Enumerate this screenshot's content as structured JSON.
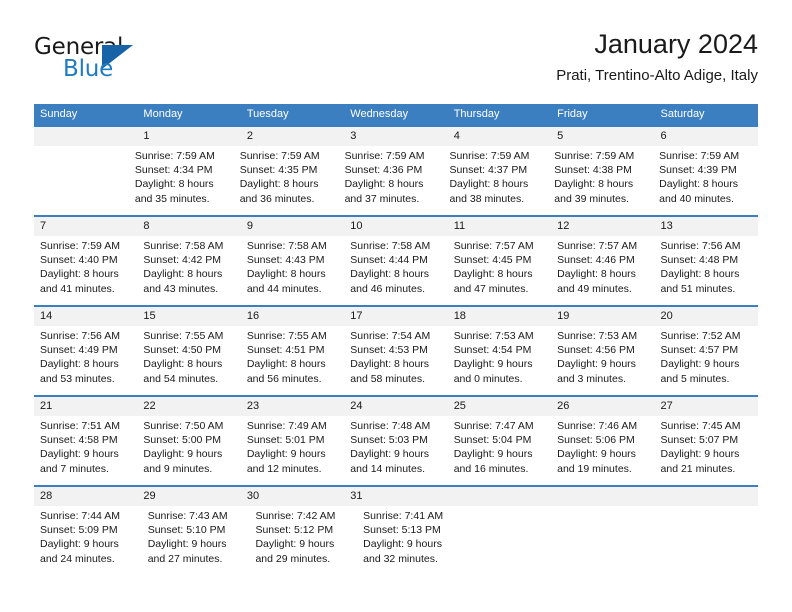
{
  "brand": {
    "name_top": "General",
    "name_bottom": "Blue",
    "triangle_color": "#1663a8",
    "blue_text_color": "#1f7bc1",
    "logo_icon": "general-blue-triangle-logo"
  },
  "header": {
    "title": "January 2024",
    "subtitle": "Prati, Trentino-Alto Adige, Italy"
  },
  "calendar": {
    "accent_color": "#3c7fc0",
    "daynum_band_color": "#f2f2f2",
    "weekdays": [
      "Sunday",
      "Monday",
      "Tuesday",
      "Wednesday",
      "Thursday",
      "Friday",
      "Saturday"
    ],
    "weeks": [
      {
        "days": [
          {
            "num": "",
            "lines": []
          },
          {
            "num": "1",
            "lines": [
              "Sunrise: 7:59 AM",
              "Sunset: 4:34 PM",
              "Daylight: 8 hours",
              "and 35 minutes."
            ]
          },
          {
            "num": "2",
            "lines": [
              "Sunrise: 7:59 AM",
              "Sunset: 4:35 PM",
              "Daylight: 8 hours",
              "and 36 minutes."
            ]
          },
          {
            "num": "3",
            "lines": [
              "Sunrise: 7:59 AM",
              "Sunset: 4:36 PM",
              "Daylight: 8 hours",
              "and 37 minutes."
            ]
          },
          {
            "num": "4",
            "lines": [
              "Sunrise: 7:59 AM",
              "Sunset: 4:37 PM",
              "Daylight: 8 hours",
              "and 38 minutes."
            ]
          },
          {
            "num": "5",
            "lines": [
              "Sunrise: 7:59 AM",
              "Sunset: 4:38 PM",
              "Daylight: 8 hours",
              "and 39 minutes."
            ]
          },
          {
            "num": "6",
            "lines": [
              "Sunrise: 7:59 AM",
              "Sunset: 4:39 PM",
              "Daylight: 8 hours",
              "and 40 minutes."
            ]
          }
        ]
      },
      {
        "days": [
          {
            "num": "7",
            "lines": [
              "Sunrise: 7:59 AM",
              "Sunset: 4:40 PM",
              "Daylight: 8 hours",
              "and 41 minutes."
            ]
          },
          {
            "num": "8",
            "lines": [
              "Sunrise: 7:58 AM",
              "Sunset: 4:42 PM",
              "Daylight: 8 hours",
              "and 43 minutes."
            ]
          },
          {
            "num": "9",
            "lines": [
              "Sunrise: 7:58 AM",
              "Sunset: 4:43 PM",
              "Daylight: 8 hours",
              "and 44 minutes."
            ]
          },
          {
            "num": "10",
            "lines": [
              "Sunrise: 7:58 AM",
              "Sunset: 4:44 PM",
              "Daylight: 8 hours",
              "and 46 minutes."
            ]
          },
          {
            "num": "11",
            "lines": [
              "Sunrise: 7:57 AM",
              "Sunset: 4:45 PM",
              "Daylight: 8 hours",
              "and 47 minutes."
            ]
          },
          {
            "num": "12",
            "lines": [
              "Sunrise: 7:57 AM",
              "Sunset: 4:46 PM",
              "Daylight: 8 hours",
              "and 49 minutes."
            ]
          },
          {
            "num": "13",
            "lines": [
              "Sunrise: 7:56 AM",
              "Sunset: 4:48 PM",
              "Daylight: 8 hours",
              "and 51 minutes."
            ]
          }
        ]
      },
      {
        "days": [
          {
            "num": "14",
            "lines": [
              "Sunrise: 7:56 AM",
              "Sunset: 4:49 PM",
              "Daylight: 8 hours",
              "and 53 minutes."
            ]
          },
          {
            "num": "15",
            "lines": [
              "Sunrise: 7:55 AM",
              "Sunset: 4:50 PM",
              "Daylight: 8 hours",
              "and 54 minutes."
            ]
          },
          {
            "num": "16",
            "lines": [
              "Sunrise: 7:55 AM",
              "Sunset: 4:51 PM",
              "Daylight: 8 hours",
              "and 56 minutes."
            ]
          },
          {
            "num": "17",
            "lines": [
              "Sunrise: 7:54 AM",
              "Sunset: 4:53 PM",
              "Daylight: 8 hours",
              "and 58 minutes."
            ]
          },
          {
            "num": "18",
            "lines": [
              "Sunrise: 7:53 AM",
              "Sunset: 4:54 PM",
              "Daylight: 9 hours",
              "and 0 minutes."
            ]
          },
          {
            "num": "19",
            "lines": [
              "Sunrise: 7:53 AM",
              "Sunset: 4:56 PM",
              "Daylight: 9 hours",
              "and 3 minutes."
            ]
          },
          {
            "num": "20",
            "lines": [
              "Sunrise: 7:52 AM",
              "Sunset: 4:57 PM",
              "Daylight: 9 hours",
              "and 5 minutes."
            ]
          }
        ]
      },
      {
        "days": [
          {
            "num": "21",
            "lines": [
              "Sunrise: 7:51 AM",
              "Sunset: 4:58 PM",
              "Daylight: 9 hours",
              "and 7 minutes."
            ]
          },
          {
            "num": "22",
            "lines": [
              "Sunrise: 7:50 AM",
              "Sunset: 5:00 PM",
              "Daylight: 9 hours",
              "and 9 minutes."
            ]
          },
          {
            "num": "23",
            "lines": [
              "Sunrise: 7:49 AM",
              "Sunset: 5:01 PM",
              "Daylight: 9 hours",
              "and 12 minutes."
            ]
          },
          {
            "num": "24",
            "lines": [
              "Sunrise: 7:48 AM",
              "Sunset: 5:03 PM",
              "Daylight: 9 hours",
              "and 14 minutes."
            ]
          },
          {
            "num": "25",
            "lines": [
              "Sunrise: 7:47 AM",
              "Sunset: 5:04 PM",
              "Daylight: 9 hours",
              "and 16 minutes."
            ]
          },
          {
            "num": "26",
            "lines": [
              "Sunrise: 7:46 AM",
              "Sunset: 5:06 PM",
              "Daylight: 9 hours",
              "and 19 minutes."
            ]
          },
          {
            "num": "27",
            "lines": [
              "Sunrise: 7:45 AM",
              "Sunset: 5:07 PM",
              "Daylight: 9 hours",
              "and 21 minutes."
            ]
          }
        ]
      },
      {
        "days": [
          {
            "num": "28",
            "lines": [
              "Sunrise: 7:44 AM",
              "Sunset: 5:09 PM",
              "Daylight: 9 hours",
              "and 24 minutes."
            ]
          },
          {
            "num": "29",
            "lines": [
              "Sunrise: 7:43 AM",
              "Sunset: 5:10 PM",
              "Daylight: 9 hours",
              "and 27 minutes."
            ]
          },
          {
            "num": "30",
            "lines": [
              "Sunrise: 7:42 AM",
              "Sunset: 5:12 PM",
              "Daylight: 9 hours",
              "and 29 minutes."
            ]
          },
          {
            "num": "31",
            "lines": [
              "Sunrise: 7:41 AM",
              "Sunset: 5:13 PM",
              "Daylight: 9 hours",
              "and 32 minutes."
            ]
          },
          {
            "num": "",
            "lines": []
          },
          {
            "num": "",
            "lines": []
          },
          {
            "num": "",
            "lines": []
          }
        ]
      }
    ]
  }
}
